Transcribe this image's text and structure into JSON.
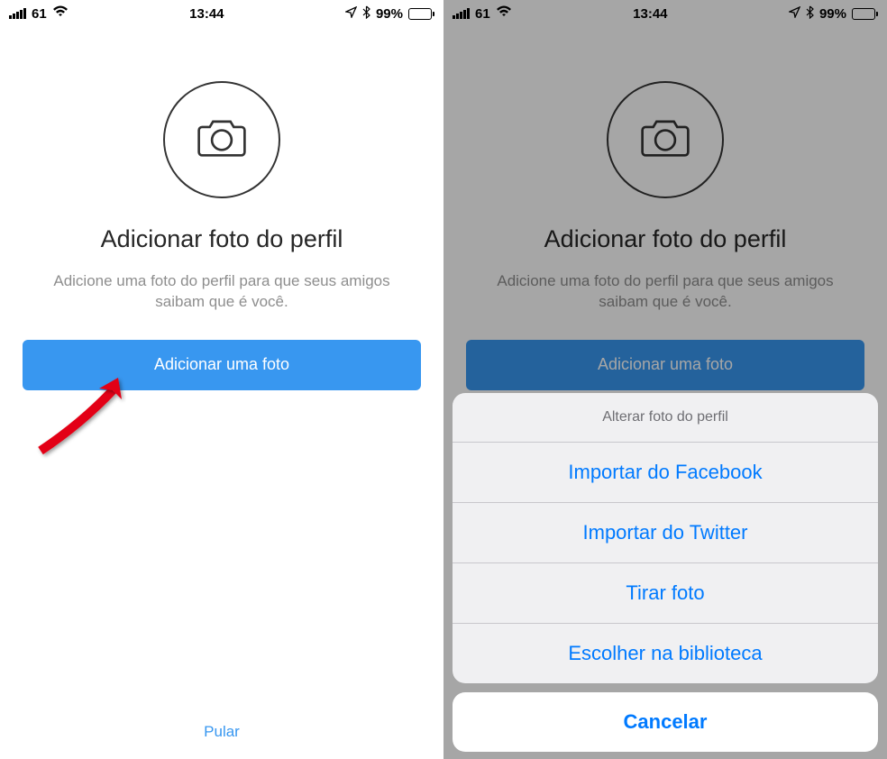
{
  "status_bar": {
    "wifi_strength": "61",
    "wifi_icon": "wifi",
    "time": "13:44",
    "location_icon": "location",
    "bluetooth_icon": "bluetooth",
    "battery_percent": "99%"
  },
  "screen1": {
    "title": "Adicionar foto do perfil",
    "subtitle": "Adicione uma foto do perfil para que seus amigos saibam que é você.",
    "button_label": "Adicionar uma foto",
    "skip_label": "Pular"
  },
  "screen2": {
    "title": "Adicionar foto do perfil",
    "subtitle": "Adicione uma foto do perfil para que seus amigos saibam que é você.",
    "button_label": "Adicionar uma foto",
    "action_sheet": {
      "header": "Alterar foto do perfil",
      "options": [
        "Importar do Facebook",
        "Importar do Twitter",
        "Tirar foto",
        "Escolher na biblioteca"
      ],
      "cancel": "Cancelar"
    }
  },
  "colors": {
    "primary_blue": "#3897f0",
    "ios_blue": "#007aff",
    "text_dark": "#262626",
    "text_grey": "#8e8e8e"
  }
}
